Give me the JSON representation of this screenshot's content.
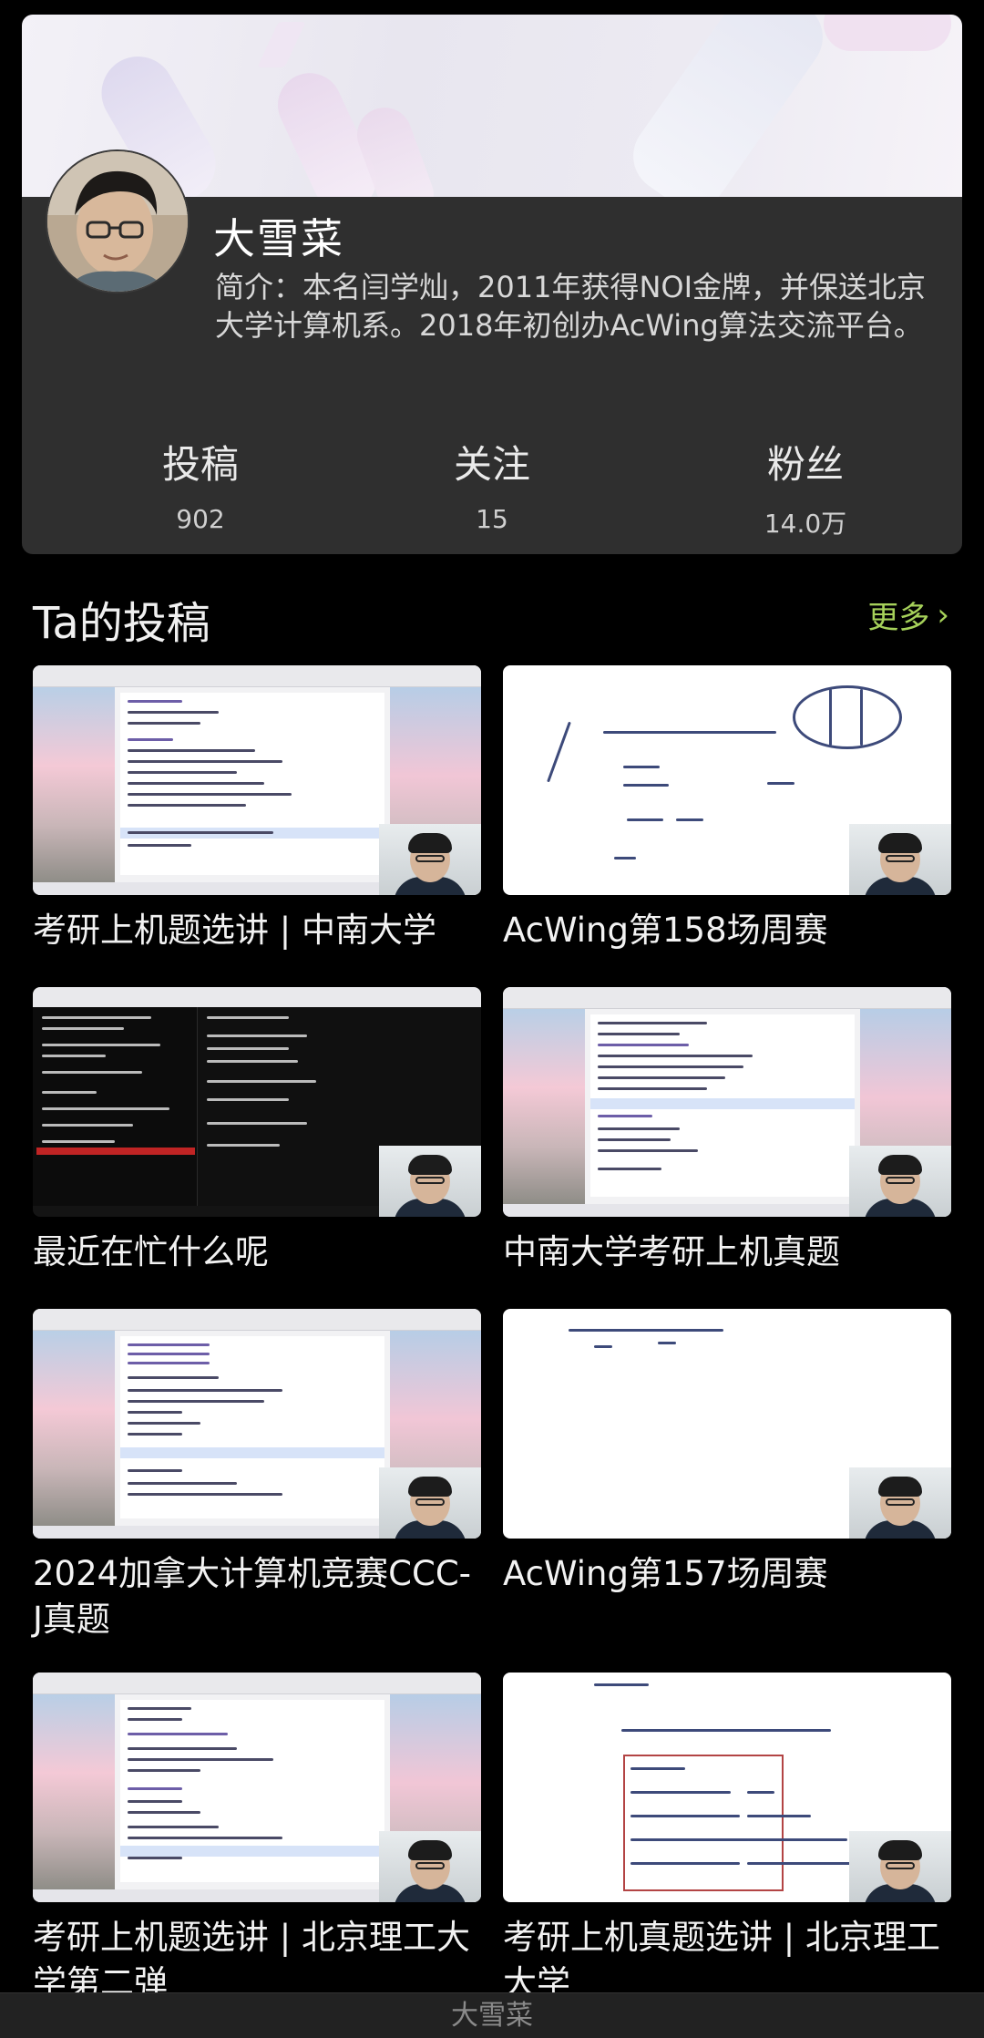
{
  "profile": {
    "nickname": "大雪菜",
    "bio": "简介：本名闫学灿，2011年获得NOI金牌，并保送北京大学计算机系。2018年初创办AcWing算法交流平台。",
    "stats": [
      {
        "label": "投稿",
        "value": "902"
      },
      {
        "label": "关注",
        "value": "15"
      },
      {
        "label": "粉丝",
        "value": "14.0万"
      }
    ]
  },
  "section": {
    "title": "Ta的投稿",
    "more_label": "更多",
    "more_icon": "chevron-right-icon",
    "accent_color": "#a6d15a"
  },
  "videos": [
    {
      "title": "考研上机题选讲 | 中南大学",
      "thumb": "code-editor"
    },
    {
      "title": "AcWing第158场周赛",
      "thumb": "whiteboard"
    },
    {
      "title": "最近在忙什么呢",
      "thumb": "dark-terminal"
    },
    {
      "title": "中南大学考研上机真题",
      "thumb": "code-editor"
    },
    {
      "title": "2024加拿大计算机竞赛CCC-J真题",
      "thumb": "code-editor"
    },
    {
      "title": "AcWing第157场周赛",
      "thumb": "whiteboard"
    },
    {
      "title": "考研上机题选讲 | 北京理工大学第二弹",
      "thumb": "code-editor"
    },
    {
      "title": "考研上机真题选讲 | 北京理工大学",
      "thumb": "whiteboard"
    }
  ],
  "bottom_bar": {
    "label": "大雪菜"
  }
}
